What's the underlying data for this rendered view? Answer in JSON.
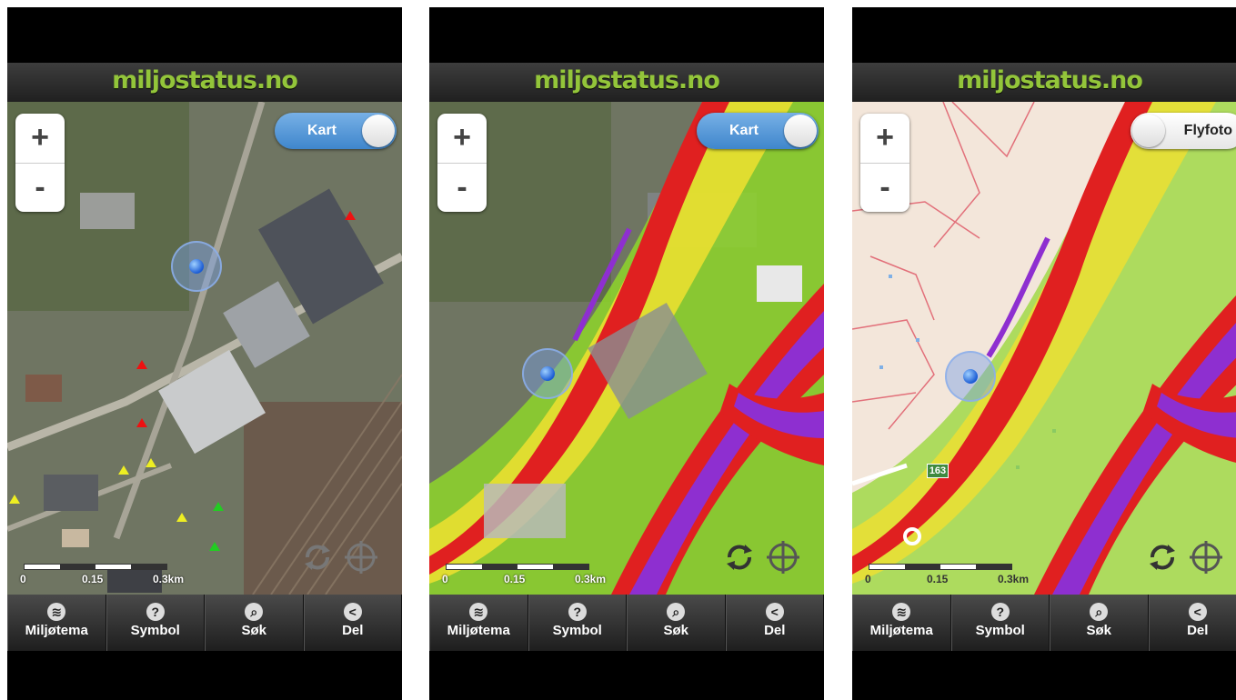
{
  "app": {
    "logo_text": "miljostatus.no"
  },
  "screens": [
    {
      "zoom_in": "+",
      "zoom_out": "-",
      "toggle_label": "Kart",
      "toggle_state": "on",
      "scale": {
        "labels": [
          "0",
          "0.15",
          "0.3km"
        ]
      },
      "tabs": [
        {
          "label": "Miljøtema",
          "icon": "layers-icon"
        },
        {
          "label": "Symbol",
          "icon": "question-icon"
        },
        {
          "label": "Søk",
          "icon": "search-icon"
        },
        {
          "label": "Del",
          "icon": "share-icon"
        }
      ]
    },
    {
      "zoom_in": "+",
      "zoom_out": "-",
      "toggle_label": "Kart",
      "toggle_state": "on",
      "scale": {
        "labels": [
          "0",
          "0.15",
          "0.3km"
        ]
      },
      "tabs": [
        {
          "label": "Miljøtema",
          "icon": "layers-icon"
        },
        {
          "label": "Symbol",
          "icon": "question-icon"
        },
        {
          "label": "Søk",
          "icon": "search-icon"
        },
        {
          "label": "Del",
          "icon": "share-icon"
        }
      ]
    },
    {
      "zoom_in": "+",
      "zoom_out": "-",
      "toggle_label": "Flyfoto",
      "toggle_state": "off",
      "scale": {
        "labels": [
          "0",
          "0.15",
          "0.3km"
        ]
      },
      "road_label": "163",
      "tabs": [
        {
          "label": "Miljøtema",
          "icon": "layers-icon"
        },
        {
          "label": "Symbol",
          "icon": "question-icon"
        },
        {
          "label": "Søk",
          "icon": "search-icon"
        },
        {
          "label": "Del",
          "icon": "share-icon"
        }
      ]
    }
  ],
  "colors": {
    "brand_green": "#93c53a",
    "toggle_blue": "#4a8fd4",
    "noise_red": "#e02020",
    "noise_purple": "#8e2fd0",
    "noise_yellow": "#f0e030",
    "noise_green": "#8ed62a"
  }
}
